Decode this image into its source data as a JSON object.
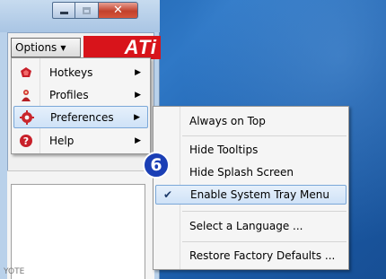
{
  "window": {
    "minimize_label": "",
    "maximize_label": "",
    "close_label": "✕"
  },
  "toolbar": {
    "options_label": "Options",
    "logo_text": "ATi"
  },
  "menu": {
    "items": [
      {
        "label": "Hotkeys",
        "icon": "hotkeys-icon",
        "has_submenu": true
      },
      {
        "label": "Profiles",
        "icon": "profiles-icon",
        "has_submenu": true
      },
      {
        "label": "Preferences",
        "icon": "preferences-icon",
        "has_submenu": true,
        "selected": true
      },
      {
        "label": "Help",
        "icon": "help-icon",
        "has_submenu": true
      }
    ]
  },
  "submenu": {
    "items": [
      {
        "label": "Always on Top",
        "checked": false
      },
      {
        "label": "Hide Tooltips",
        "checked": false
      },
      {
        "label": "Hide Splash Screen",
        "checked": false
      },
      {
        "label": "Enable System Tray Menu",
        "checked": true,
        "highlighted": true
      },
      {
        "label": "Select a Language ...",
        "checked": false
      },
      {
        "label": "Restore Factory Defaults ...",
        "checked": false
      }
    ]
  },
  "step_badge": "6",
  "partial_text": "YOTE",
  "colors": {
    "accent_red": "#d8141b",
    "badge_blue": "#1b3fb5",
    "highlight": "#cfe2f7"
  }
}
